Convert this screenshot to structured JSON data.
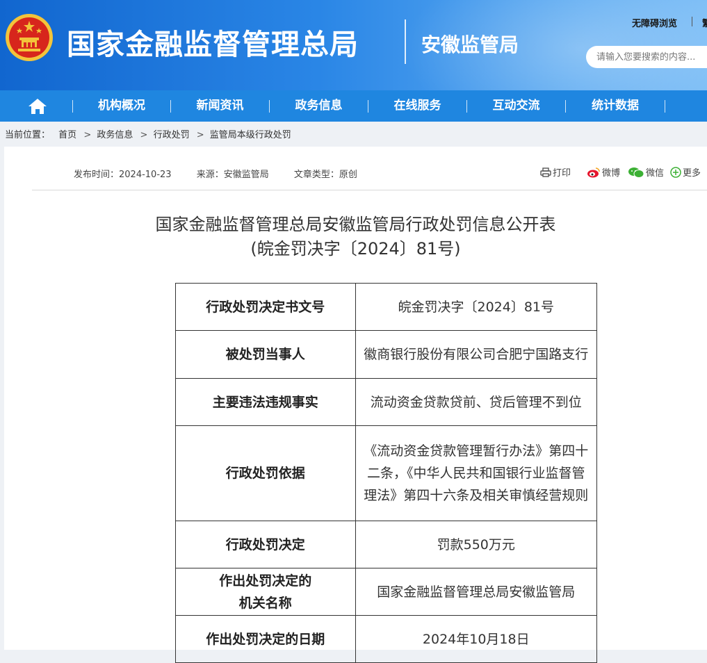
{
  "header": {
    "site_title": "国家金融监督管理总局",
    "sub_title": "安徽监管局",
    "accessibility_link": "无障碍浏览",
    "second_link": "繁",
    "search_placeholder": "请输入您要搜索的内容..."
  },
  "nav": {
    "home_icon": "home-icon",
    "items": [
      {
        "label": "机构概况"
      },
      {
        "label": "新闻资讯"
      },
      {
        "label": "政务信息"
      },
      {
        "label": "在线服务"
      },
      {
        "label": "互动交流"
      },
      {
        "label": "统计数据"
      }
    ]
  },
  "breadcrumb": {
    "prefix": "当前位置：",
    "items": [
      "首页",
      "政务信息",
      "行政处罚",
      "监管局本级行政处罚"
    ],
    "separator": ">"
  },
  "article": {
    "publish_time": "发布时间：2024-10-23",
    "source": "来源：安徽监管局",
    "type": "文章类型：原创",
    "share": {
      "print": "打印",
      "weibo": "微博",
      "wechat": "微信",
      "more": "更多"
    },
    "title_line1": "国家金融监督管理总局安徽监管局行政处罚信息公开表",
    "title_line2": "(皖金罚决字〔2024〕81号)"
  },
  "table": {
    "rows": [
      {
        "label": "行政处罚决定书文号",
        "value": "皖金罚决字〔2024〕81号"
      },
      {
        "label": "被处罚当事人",
        "value": "徽商银行股份有限公司合肥宁国路支行"
      },
      {
        "label": "主要违法违规事实",
        "value": "流动资金贷款贷前、贷后管理不到位"
      },
      {
        "label": "行政处罚依据",
        "value": "《流动资金贷款管理暂行办法》第四十二条，《中华人民共和国银行业监督管理法》第四十六条及相关审慎经营规则"
      },
      {
        "label": "行政处罚决定",
        "value": "罚款550万元"
      },
      {
        "label": "作出处罚决定的机关名称",
        "label_line1": "作出处罚决定的",
        "label_line2": "机关名称",
        "value": "国家金融监督管理总局安徽监管局"
      },
      {
        "label": "作出处罚决定的日期",
        "value": "2024年10月18日"
      }
    ]
  },
  "colors": {
    "header_blue": "#1166cf",
    "nav_blue": "#1f86e0",
    "emblem_red": "#d7261c",
    "emblem_gold": "#f3c43a"
  }
}
